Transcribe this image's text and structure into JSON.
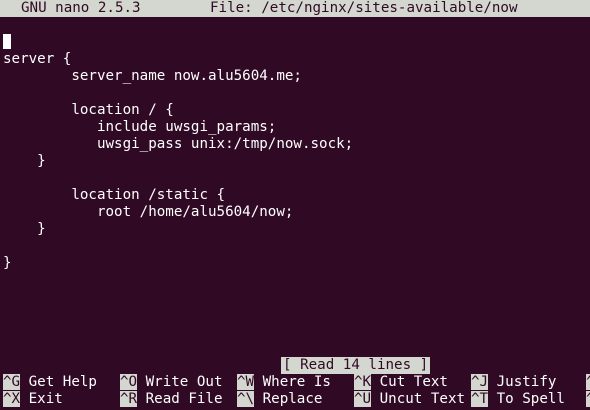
{
  "titlebar": {
    "app": "GNU nano 2.5.3",
    "file": "File: /etc/nginx/sites-available/now"
  },
  "editor": {
    "lines": [
      "",
      "server {",
      "        server_name now.alu5604.me;",
      "",
      "        location / {",
      "           include uwsgi_params;",
      "           uwsgi_pass unix:/tmp/now.sock;",
      "    }",
      "",
      "        location /static {",
      "           root /home/alu5604/now;",
      "    }",
      "",
      "}"
    ]
  },
  "status": {
    "message": "[ Read 14 lines ]"
  },
  "shortcuts": {
    "row1": [
      {
        "key": "^G",
        "label": " Get Help"
      },
      {
        "key": "^O",
        "label": " Write Out"
      },
      {
        "key": "^W",
        "label": " Where Is"
      },
      {
        "key": "^K",
        "label": " Cut Text"
      },
      {
        "key": "^J",
        "label": " Justify"
      },
      {
        "key": "^C",
        "label": ""
      }
    ],
    "row2": [
      {
        "key": "^X",
        "label": " Exit"
      },
      {
        "key": "^R",
        "label": " Read File"
      },
      {
        "key": "^\\",
        "label": " Replace"
      },
      {
        "key": "^U",
        "label": " Uncut Text"
      },
      {
        "key": "^T",
        "label": " To Spell"
      },
      {
        "key": "^_",
        "label": ""
      }
    ]
  },
  "colors": {
    "background": "#300a24",
    "foreground": "#ffffff",
    "inverse": "#d3d7cf"
  }
}
